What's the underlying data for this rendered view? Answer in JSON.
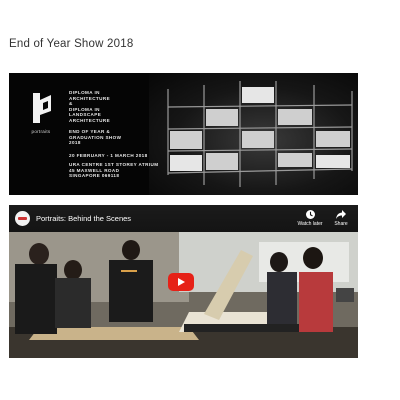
{
  "page": {
    "title": "End of Year Show 2018"
  },
  "banner": {
    "logo_word": "portraits",
    "program_lines": "DIPLOMA IN\nARCHITECTURE\n&\nDIPLOMA IN\nLANDSCAPE\nARCHITECTURE",
    "event_lines": "END OF YEAR &\nGRADUATION SHOW\n2018",
    "dates": "20 FEBRUARY - 1 MARCH 2018",
    "venue_lines": "URA CENTRE 1ST STOREY ATRIUM\n45 MAXWELL ROAD\nSINGAPORE 069118"
  },
  "video": {
    "title": "Portraits: Behind the Scenes",
    "watch_later_label": "Watch later",
    "share_label": "Share",
    "play_color": "#e62117"
  }
}
